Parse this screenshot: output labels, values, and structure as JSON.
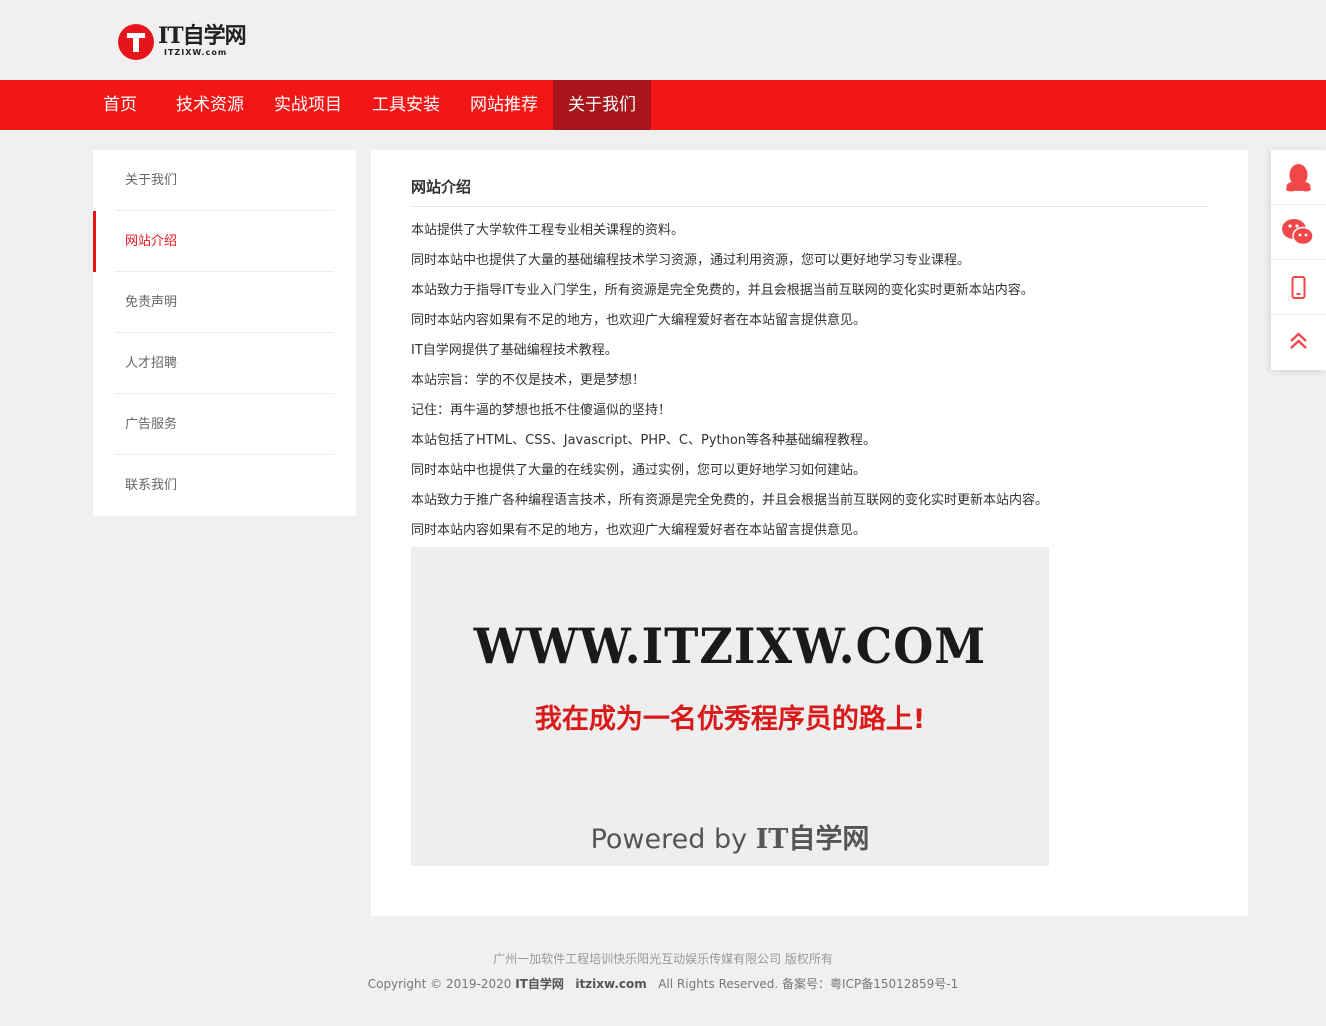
{
  "header": {
    "logo_name": "IT自学网",
    "logo_domain": "ITZIXW.com"
  },
  "nav": {
    "items": [
      {
        "label": "首页"
      },
      {
        "label": "技术资源"
      },
      {
        "label": "实战项目"
      },
      {
        "label": "工具安装"
      },
      {
        "label": "网站推荐"
      },
      {
        "label": "关于我们",
        "active": true
      }
    ]
  },
  "sidebar": {
    "items": [
      {
        "label": "关于我们"
      },
      {
        "label": "网站介绍",
        "active": true
      },
      {
        "label": "免责声明"
      },
      {
        "label": "人才招聘"
      },
      {
        "label": "广告服务"
      },
      {
        "label": "联系我们"
      }
    ]
  },
  "content": {
    "title": "网站介绍",
    "paragraphs": [
      "本站提供了大学软件工程专业相关课程的资料。",
      "同时本站中也提供了大量的基础编程技术学习资源，通过利用资源，您可以更好地学习专业课程。",
      "本站致力于指导IT专业入门学生，所有资源是完全免费的，并且会根据当前互联网的变化实时更新本站内容。",
      "同时本站内容如果有不足的地方，也欢迎广大编程爱好者在本站留言提供意见。",
      "IT自学网提供了基础编程技术教程。",
      "本站宗旨：学的不仅是技术，更是梦想！",
      "记住：再牛逼的梦想也抵不住傻逼似的坚持！",
      "本站包括了HTML、CSS、Javascript、PHP、C、Python等各种基础编程教程。",
      "同时本站中也提供了大量的在线实例，通过实例，您可以更好地学习如何建站。",
      "本站致力于推广各种编程语言技术，所有资源是完全免费的，并且会根据当前互联网的变化实时更新本站内容。",
      "同时本站内容如果有不足的地方，也欢迎广大编程爱好者在本站留言提供意见。"
    ],
    "banner": {
      "url": "WWW.ITZIXW.COM",
      "slogan": "我在成为一名优秀程序员的路上!",
      "powered_prefix": "Powered by",
      "powered_brand": "IT自学网"
    }
  },
  "footer": {
    "line1": "广州一加软件工程培训快乐阳光互动娱乐传媒有限公司 版权所有",
    "copyright": "Copyright © 2019-2020",
    "brand": "IT自学网",
    "domain": "itzixw.com",
    "rights": "All Rights Reserved. 备案号：粤ICP备15012859号-1"
  },
  "float_bar": {
    "icons": [
      "qq-icon",
      "wechat-icon",
      "mobile-icon",
      "back-to-top-icon"
    ],
    "accent": "#e8141c"
  },
  "colors": {
    "brand_red": "#f31616",
    "nav_active": "#a8161b",
    "accent": "#e8141c",
    "page_bg": "#f0f0f0"
  }
}
